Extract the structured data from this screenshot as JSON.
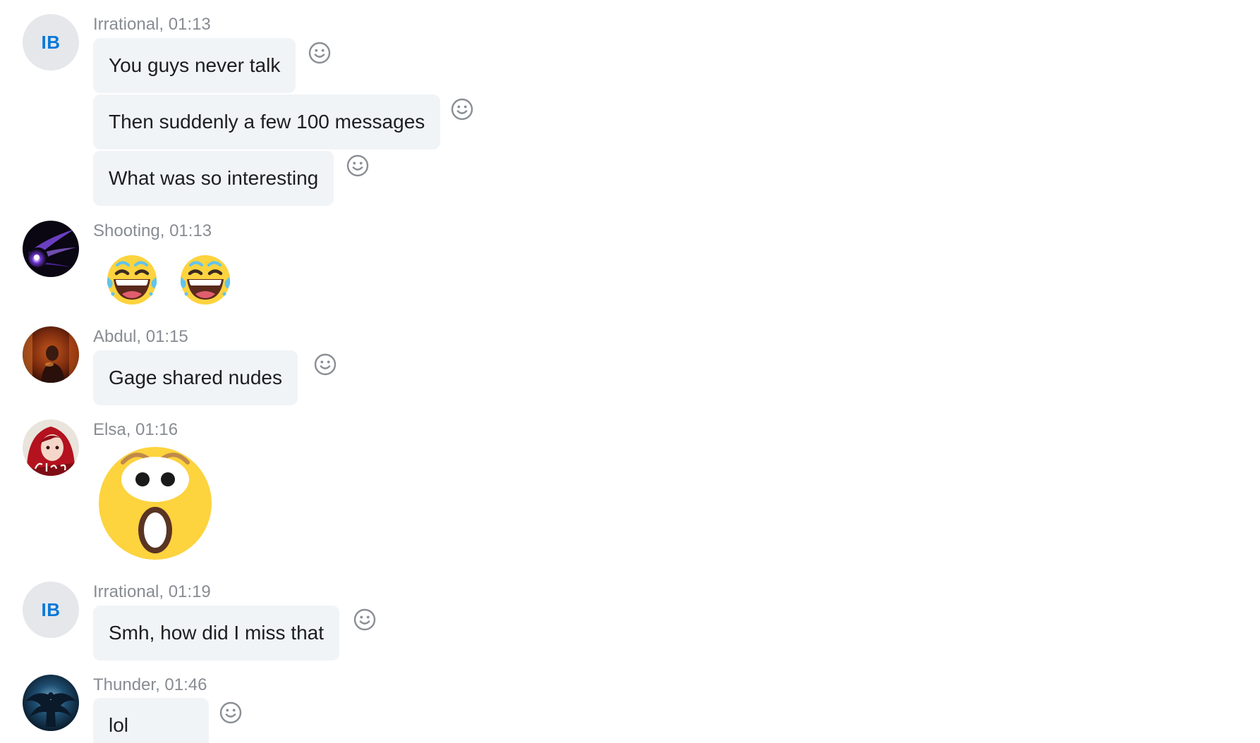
{
  "messages": [
    {
      "sender": "Irrational, 01:13",
      "avatar": {
        "type": "initials",
        "text": "IB"
      },
      "bubbles": [
        "You guys never talk",
        "Then suddenly a few 100 messages",
        "What was so interesting"
      ]
    },
    {
      "sender": "Shooting, 01:13",
      "avatar": {
        "type": "image",
        "icon": "shooting-star-avatar"
      },
      "emojis": [
        "tears-of-joy-emoji",
        "tears-of-joy-emoji"
      ]
    },
    {
      "sender": "Abdul, 01:15",
      "avatar": {
        "type": "image",
        "icon": "portrait-photo-avatar"
      },
      "bubbles": [
        "Gage shared nudes"
      ]
    },
    {
      "sender": "Elsa, 01:16",
      "avatar": {
        "type": "image",
        "icon": "anime-girl-avatar"
      },
      "emojis": [
        "astonished-face-emoji"
      ]
    },
    {
      "sender": "Irrational, 01:19",
      "avatar": {
        "type": "initials",
        "text": "IB"
      },
      "bubbles": [
        "Smh, how did I miss that"
      ]
    },
    {
      "sender": "Thunder, 01:46",
      "avatar": {
        "type": "image",
        "icon": "dark-angel-avatar"
      },
      "bubbles": [
        "lol"
      ]
    }
  ],
  "reaction_icon": "smiley-reaction-icon",
  "colors": {
    "bubble_bg": "#f1f4f7",
    "initials_avatar_bg": "#e5e7eb",
    "initials_text": "#0a78d8",
    "sender_text": "#888c92",
    "message_text": "#1c1e21",
    "emoji_yellow": "#fdd33e"
  }
}
